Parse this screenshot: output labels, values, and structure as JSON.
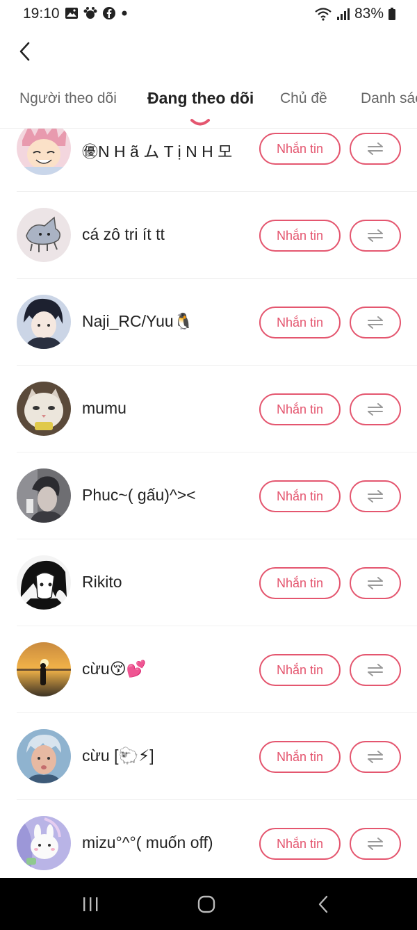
{
  "status_bar": {
    "time": "19:10",
    "battery": "83%"
  },
  "tabs": [
    {
      "label": "Người theo dõi"
    },
    {
      "label": "Đang theo dõi"
    },
    {
      "label": "Chủ đề"
    },
    {
      "label": "Danh sách"
    }
  ],
  "active_tab_index": 1,
  "message_label": "Nhắn tin",
  "users": [
    {
      "name": "㊝N H ã ム T ị N H 모"
    },
    {
      "name": "cá zô tri ít tt"
    },
    {
      "name": "Naji_RC/Yuu🐧"
    },
    {
      "name": "mumu"
    },
    {
      "name": "Phuc~( gấu)^><"
    },
    {
      "name": "Rikito"
    },
    {
      "name": "cừu😚💕"
    },
    {
      "name": "cừu [🐑⚡]"
    },
    {
      "name": "mizu°^°( muốn off)"
    }
  ],
  "colors": {
    "accent": "#e4566f",
    "navbar": "#000000",
    "text": "#222222"
  },
  "icons": {
    "back": "chevron-left-icon",
    "swap": "swap-arrows-icon",
    "nav_recent": "recent-apps-icon",
    "nav_home": "home-icon",
    "nav_back": "back-icon"
  }
}
